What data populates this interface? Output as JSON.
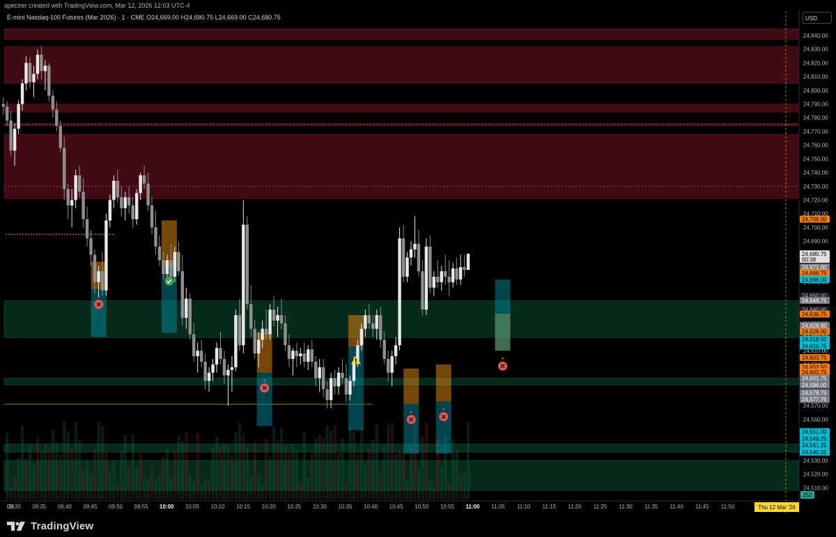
{
  "header": {
    "attribution": "spectrer created with TradingView.com, Mar 12, 2026 12:03 UTC-4",
    "symbol_line": "E-mini Nasdaq-100 Futures (Mar 2026) · 1 · CME  O24,669.00  H24,680.75  L24,669.00  C24,680.75",
    "currency": "USD"
  },
  "brand": {
    "name": "TradingView"
  },
  "chart_data": {
    "type": "candlestick",
    "symbol": "E-mini Nasdaq-100 Futures (Mar 2026)",
    "interval": "1",
    "exchange": "CME",
    "ohlc": {
      "open": 24669.0,
      "high": 24680.75,
      "low": 24669.0,
      "close": 24680.75
    },
    "ylim": [
      24500,
      24850
    ],
    "y_ticks": [
      24510,
      24520,
      24530,
      24540,
      24550,
      24560,
      24570,
      24580,
      24590,
      24600,
      24610,
      24620,
      24630,
      24640,
      24650,
      24660,
      24670,
      24680,
      24690,
      24700,
      24710,
      24720,
      24730,
      24740,
      24750,
      24760,
      24770,
      24780,
      24790,
      24800,
      24810,
      24820,
      24830,
      24840
    ],
    "x_ticks": [
      {
        "label": "25",
        "t": -0.5
      },
      {
        "label": "09:30",
        "t": 0
      },
      {
        "label": "09:35",
        "t": 5
      },
      {
        "label": "09:40",
        "t": 10
      },
      {
        "label": "09:45",
        "t": 15
      },
      {
        "label": "09:50",
        "t": 20
      },
      {
        "label": "09:55",
        "t": 25
      },
      {
        "label": "10:00",
        "t": 30,
        "bold": true
      },
      {
        "label": "10:05",
        "t": 35
      },
      {
        "label": "10:10",
        "t": 40
      },
      {
        "label": "10:15",
        "t": 45
      },
      {
        "label": "10:20",
        "t": 50
      },
      {
        "label": "10:25",
        "t": 55
      },
      {
        "label": "10:30",
        "t": 60
      },
      {
        "label": "10:35",
        "t": 65
      },
      {
        "label": "10:40",
        "t": 70
      },
      {
        "label": "10:45",
        "t": 75
      },
      {
        "label": "10:50",
        "t": 80
      },
      {
        "label": "10:55",
        "t": 85
      },
      {
        "label": "11:00",
        "t": 90,
        "bold": true
      },
      {
        "label": "11:05",
        "t": 95
      },
      {
        "label": "11:10",
        "t": 100
      },
      {
        "label": "11:15",
        "t": 105
      },
      {
        "label": "11:20",
        "t": 110
      },
      {
        "label": "11:25",
        "t": 115
      },
      {
        "label": "11:30",
        "t": 120
      },
      {
        "label": "11:35",
        "t": 125
      },
      {
        "label": "11:40",
        "t": 130
      },
      {
        "label": "11:45",
        "t": 135
      },
      {
        "label": "11:50",
        "t": 140
      }
    ],
    "date_label": "Thu 12 Mar '26",
    "volume_label": "253",
    "price_labels": [
      {
        "price": 24706.0,
        "text": "24,706.00",
        "color": "#f57c00",
        "fg": "#000000"
      },
      {
        "price": 24680.75,
        "text": "24,680.75",
        "sub": "00:38",
        "color": "#e0e0e0",
        "fg": "#000000"
      },
      {
        "price": 24671.0,
        "text": "24,671.00",
        "color": "#787b86",
        "fg": "#ffffff"
      },
      {
        "price": 24666.75,
        "text": "24,666.75",
        "color": "#f57c00",
        "fg": "#000000"
      },
      {
        "price": 24662.0,
        "text": "24,666.00",
        "color": "#00bcd4",
        "fg": "#000000"
      },
      {
        "price": 24650.25,
        "text": "24,650.00",
        "color": "#1a1a1a",
        "fg": "#b2b5be"
      },
      {
        "price": 24646.75,
        "text": "24,646.75",
        "color": "#787b86",
        "fg": "#ffffff"
      },
      {
        "price": 24640.0,
        "text": "24,640.00",
        "color": "#1a1a1a",
        "fg": "#b2b5be"
      },
      {
        "price": 24636.75,
        "text": "24,636.75",
        "color": "#f57c00",
        "fg": "#000000"
      },
      {
        "price": 24628.5,
        "text": "24,628.50",
        "color": "#787b86",
        "fg": "#ffffff"
      },
      {
        "price": 24624.0,
        "text": "24,626.00",
        "color": "#f57c00",
        "fg": "#000000"
      },
      {
        "price": 24618.5,
        "text": "24,618.50",
        "color": "#00bcd4",
        "fg": "#000000"
      },
      {
        "price": 24613.5,
        "text": "24,616.75",
        "color": "#00bcd4",
        "fg": "#000000"
      },
      {
        "price": 24605.0,
        "text": "24,603.75",
        "color": "#f57c00",
        "fg": "#000000"
      },
      {
        "price": 24598.0,
        "text": "24,603.50",
        "color": "#f57c00",
        "fg": "#000000"
      },
      {
        "price": 24594.5,
        "text": "24,602.75",
        "color": "#f57c00",
        "fg": "#000000"
      },
      {
        "price": 24590.0,
        "text": "24,601.75",
        "color": "#787b86",
        "fg": "#ffffff"
      },
      {
        "price": 24585.0,
        "text": "24,596.00",
        "color": "#787b86",
        "fg": "#ffffff"
      },
      {
        "price": 24579.5,
        "text": "24,578.75",
        "color": "#787b86",
        "fg": "#ffffff"
      },
      {
        "price": 24574.5,
        "text": "24,577.75",
        "color": "#787b86",
        "fg": "#ffffff"
      },
      {
        "price": 24551.0,
        "text": "24,551.00",
        "color": "#00bcd4",
        "fg": "#000000"
      },
      {
        "price": 24546.0,
        "text": "24,549.25",
        "color": "#00bcd4",
        "fg": "#000000"
      },
      {
        "price": 24541.0,
        "text": "24,541.25",
        "color": "#00bcd4",
        "fg": "#000000"
      },
      {
        "price": 24536.0,
        "text": "24,540.25",
        "color": "#00bcd4",
        "fg": "#000000"
      }
    ],
    "zones": [
      {
        "kind": "supply",
        "y1": 24845,
        "y2": 24837
      },
      {
        "kind": "supply",
        "y1": 24832,
        "y2": 24805
      },
      {
        "kind": "supply",
        "y1": 24790,
        "y2": 24784
      },
      {
        "kind": "supply",
        "y1": 24776,
        "y2": 24774
      },
      {
        "kind": "supply",
        "y1": 24768,
        "y2": 24721
      },
      {
        "kind": "demand",
        "y1": 24646.5,
        "y2": 24619.5
      },
      {
        "kind": "demand",
        "y1": 24590,
        "y2": 24585
      },
      {
        "kind": "demand",
        "y1": 24542,
        "y2": 24536
      },
      {
        "kind": "demand",
        "y1": 24530,
        "y2": 24508
      }
    ],
    "trades": [
      {
        "t": -22.5,
        "entry": 24655,
        "stop": 24675,
        "target": 24620,
        "result": "loss"
      },
      {
        "t": -4,
        "entry": 24671,
        "stop": 24705,
        "target": 24623,
        "result": "win"
      },
      {
        "t": 21,
        "entry": 24594,
        "stop": 24623,
        "target": 24555,
        "result": "loss"
      },
      {
        "t": 45,
        "entry": 24613,
        "stop": 24636,
        "target": 24552,
        "result": "warning"
      },
      {
        "t": 59.5,
        "entry": 24571,
        "stop": 24597,
        "target": 24535,
        "result": "loss"
      },
      {
        "t": 68,
        "entry": 24573,
        "stop": 24600,
        "target": 24535,
        "result": "loss"
      },
      {
        "t": 83.5,
        "entry": 24610,
        "stop": 24637,
        "target": 24662,
        "result": "loss"
      }
    ],
    "candles": [
      [
        24790,
        24795,
        24782,
        24788
      ],
      [
        24788,
        24792,
        24774,
        24778
      ],
      [
        24778,
        24785,
        24752,
        24756
      ],
      [
        24756,
        24776,
        24745,
        24772
      ],
      [
        24772,
        24793,
        24768,
        24790
      ],
      [
        24790,
        24808,
        24785,
        24805
      ],
      [
        24805,
        24825,
        24800,
        24820
      ],
      [
        24820,
        24824,
        24802,
        24806
      ],
      [
        24806,
        24818,
        24795,
        24812
      ],
      [
        24812,
        24830,
        24808,
        24826
      ],
      [
        24826,
        24832,
        24808,
        24814
      ],
      [
        24814,
        24822,
        24800,
        24818
      ],
      [
        24818,
        24820,
        24792,
        24796
      ],
      [
        24796,
        24800,
        24780,
        24786
      ],
      [
        24786,
        24792,
        24770,
        24774
      ],
      [
        24774,
        24778,
        24755,
        24758
      ],
      [
        24758,
        24766,
        24720,
        24728
      ],
      [
        24728,
        24732,
        24706,
        24716
      ],
      [
        24716,
        24728,
        24700,
        24720
      ],
      [
        24720,
        24742,
        24714,
        24738
      ],
      [
        24738,
        24745,
        24722,
        24726
      ],
      [
        24726,
        24736,
        24700,
        24706
      ],
      [
        24706,
        24715,
        24686,
        24692
      ],
      [
        24692,
        24698,
        24672,
        24680
      ],
      [
        24680,
        24684,
        24652,
        24660
      ],
      [
        24660,
        24672,
        24650,
        24668
      ],
      [
        24668,
        24682,
        24650,
        24654
      ],
      [
        24654,
        24710,
        24650,
        24705
      ],
      [
        24705,
        24724,
        24700,
        24720
      ],
      [
        24720,
        24738,
        24714,
        24734
      ],
      [
        24734,
        24742,
        24718,
        24722
      ],
      [
        24722,
        24730,
        24708,
        24714
      ],
      [
        24714,
        24726,
        24705,
        24722
      ],
      [
        24722,
        24730,
        24710,
        24716
      ],
      [
        24716,
        24722,
        24700,
        24706
      ],
      [
        24706,
        24728,
        24702,
        24725
      ],
      [
        24725,
        24740,
        24720,
        24738
      ],
      [
        24738,
        24745,
        24728,
        24732
      ],
      [
        24732,
        24740,
        24712,
        24716
      ],
      [
        24716,
        24722,
        24695,
        24700
      ],
      [
        24700,
        24712,
        24680,
        24686
      ],
      [
        24686,
        24694,
        24672,
        24676
      ],
      [
        24676,
        24682,
        24662,
        24666
      ],
      [
        24666,
        24680,
        24660,
        24676
      ],
      [
        24676,
        24688,
        24660,
        24664
      ],
      [
        24664,
        24686,
        24660,
        24682
      ],
      [
        24682,
        24690,
        24665,
        24668
      ],
      [
        24668,
        24680,
        24628,
        24634
      ],
      [
        24634,
        24656,
        24626,
        24648
      ],
      [
        24648,
        24652,
        24618,
        24622
      ],
      [
        24622,
        24630,
        24602,
        24606
      ],
      [
        24606,
        24616,
        24594,
        24610
      ],
      [
        24610,
        24618,
        24598,
        24602
      ],
      [
        24602,
        24608,
        24582,
        24588
      ],
      [
        24588,
        24598,
        24580,
        24594
      ],
      [
        24594,
        24604,
        24588,
        24600
      ],
      [
        24600,
        24616,
        24594,
        24612
      ],
      [
        24612,
        24624,
        24600,
        24604
      ],
      [
        24604,
        24610,
        24586,
        24592
      ],
      [
        24592,
        24600,
        24570,
        24596
      ],
      [
        24596,
        24606,
        24580,
        24598
      ],
      [
        24598,
        24640,
        24595,
        24636
      ],
      [
        24636,
        24648,
        24610,
        24614
      ],
      [
        24614,
        24720,
        24608,
        24702
      ],
      [
        24702,
        24708,
        24640,
        24644
      ],
      [
        24644,
        24658,
        24620,
        24626
      ],
      [
        24626,
        24632,
        24604,
        24608
      ],
      [
        24608,
        24624,
        24598,
        24618
      ],
      [
        24618,
        24632,
        24612,
        24626
      ],
      [
        24626,
        24640,
        24618,
        24622
      ],
      [
        24622,
        24644,
        24618,
        24640
      ],
      [
        24640,
        24650,
        24628,
        24632
      ],
      [
        24632,
        24642,
        24620,
        24636
      ],
      [
        24636,
        24648,
        24626,
        24630
      ],
      [
        24630,
        24636,
        24610,
        24614
      ],
      [
        24614,
        24622,
        24598,
        24604
      ],
      [
        24604,
        24612,
        24592,
        24610
      ],
      [
        24610,
        24616,
        24598,
        24606
      ],
      [
        24606,
        24612,
        24600,
        24608
      ],
      [
        24608,
        24616,
        24598,
        24602
      ],
      [
        24602,
        24614,
        24596,
        24611
      ],
      [
        24611,
        24618,
        24598,
        24602
      ],
      [
        24602,
        24606,
        24584,
        24590
      ],
      [
        24590,
        24604,
        24580,
        24598
      ],
      [
        24598,
        24604,
        24576,
        24582
      ],
      [
        24582,
        24588,
        24568,
        24574
      ],
      [
        24574,
        24594,
        24568,
        24590
      ],
      [
        24590,
        24596,
        24578,
        24584
      ],
      [
        24584,
        24598,
        24578,
        24594
      ],
      [
        24594,
        24604,
        24586,
        24590
      ],
      [
        24590,
        24600,
        24572,
        24578
      ],
      [
        24578,
        24592,
        24574,
        24588
      ],
      [
        24588,
        24606,
        24584,
        24602
      ],
      [
        24602,
        24618,
        24598,
        24614
      ],
      [
        24614,
        24630,
        24610,
        24626
      ],
      [
        24626,
        24640,
        24620,
        24636
      ],
      [
        24636,
        24644,
        24626,
        24630
      ],
      [
        24630,
        24636,
        24620,
        24626
      ],
      [
        24626,
        24640,
        24618,
        24636
      ],
      [
        24636,
        24642,
        24612,
        24618
      ],
      [
        24618,
        24624,
        24600,
        24604
      ],
      [
        24604,
        24610,
        24588,
        24594
      ],
      [
        24594,
        24610,
        24584,
        24606
      ],
      [
        24606,
        24620,
        24600,
        24614
      ],
      [
        24614,
        24700,
        24610,
        24692
      ],
      [
        24692,
        24702,
        24660,
        24664
      ],
      [
        24664,
        24682,
        24660,
        24678
      ],
      [
        24678,
        24690,
        24672,
        24684
      ],
      [
        24684,
        24708,
        24678,
        24688
      ],
      [
        24688,
        24698,
        24664,
        24668
      ],
      [
        24668,
        24676,
        24636,
        24640
      ],
      [
        24640,
        24692,
        24636,
        24686
      ],
      [
        24686,
        24694,
        24652,
        24656
      ],
      [
        24656,
        24668,
        24650,
        24664
      ],
      [
        24664,
        24676,
        24656,
        24660
      ],
      [
        24660,
        24672,
        24654,
        24668
      ],
      [
        24668,
        24680,
        24658,
        24664
      ],
      [
        24664,
        24676,
        24650,
        24660
      ],
      [
        24660,
        24674,
        24656,
        24670
      ],
      [
        24670,
        24678,
        24658,
        24662
      ],
      [
        24662,
        24680,
        24658,
        24671
      ],
      [
        24671,
        24680,
        24664,
        24669
      ],
      [
        24669,
        24680.75,
        24669,
        24680.75
      ]
    ]
  }
}
